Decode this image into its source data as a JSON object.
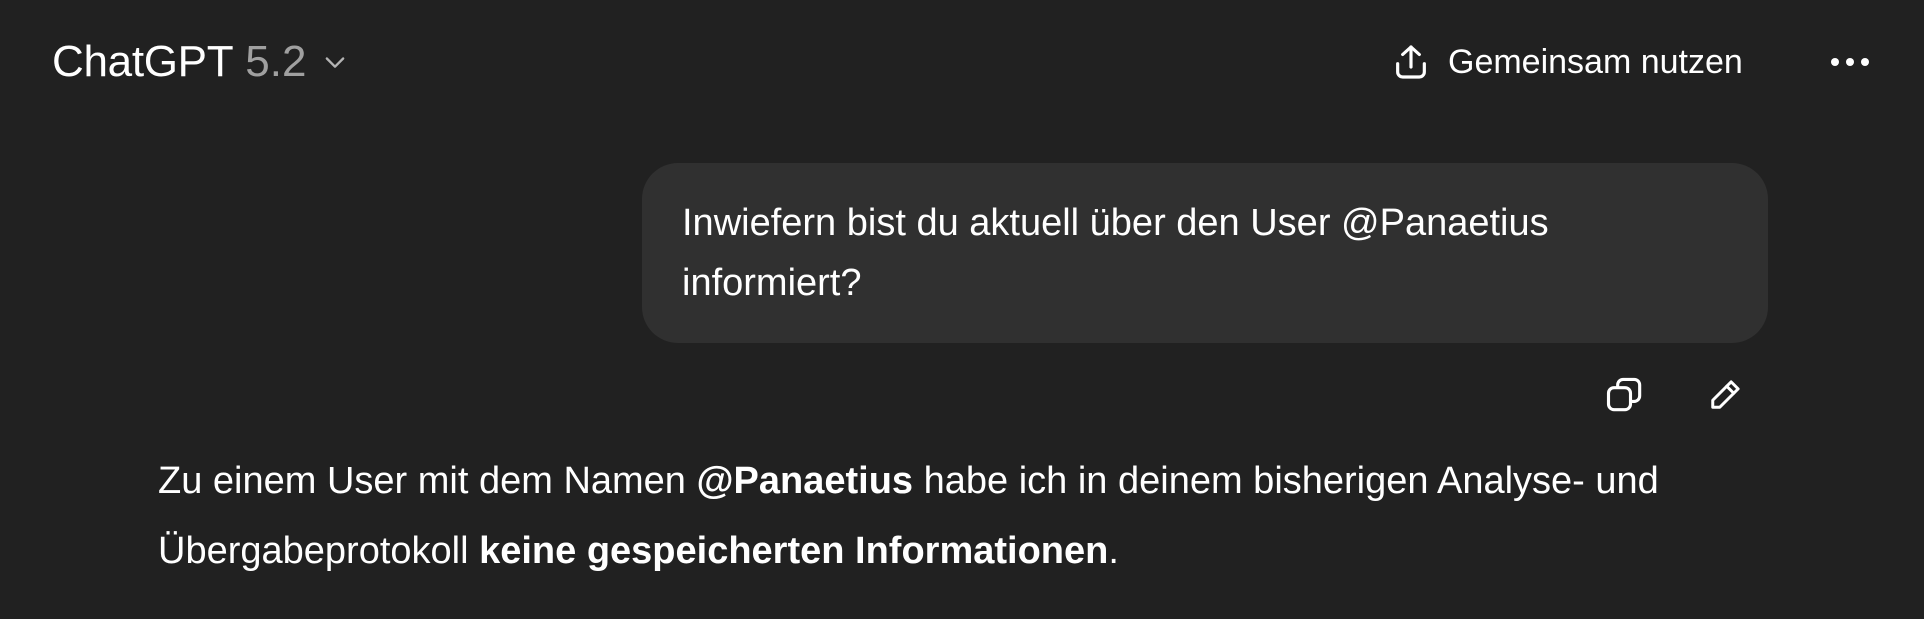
{
  "header": {
    "model_name": "ChatGPT",
    "model_version": "5.2",
    "model_chevron_icon": "chevron-down-icon",
    "share_icon": "share-upload-icon",
    "share_label": "Gemeinsam nutzen",
    "more_icon": "more-horizontal-icon"
  },
  "conversation": {
    "user_message": "Inwiefern bist du aktuell über den User @Panaetius informiert?",
    "user_message_actions": {
      "copy_icon": "copy-icon",
      "edit_icon": "edit-pencil-icon"
    },
    "assistant_message": {
      "part1": "Zu einem User mit dem Namen ",
      "bold1": "@Panaetius",
      "part2": " habe ich in deinem bisherigen Analyse- und Übergabeprotokoll ",
      "bold2": "keine gespeicherten Informationen",
      "part3": "."
    }
  },
  "colors": {
    "background": "#212121",
    "user_bubble": "#303030",
    "text": "#ffffff",
    "version_text": "#a0a0a0"
  }
}
